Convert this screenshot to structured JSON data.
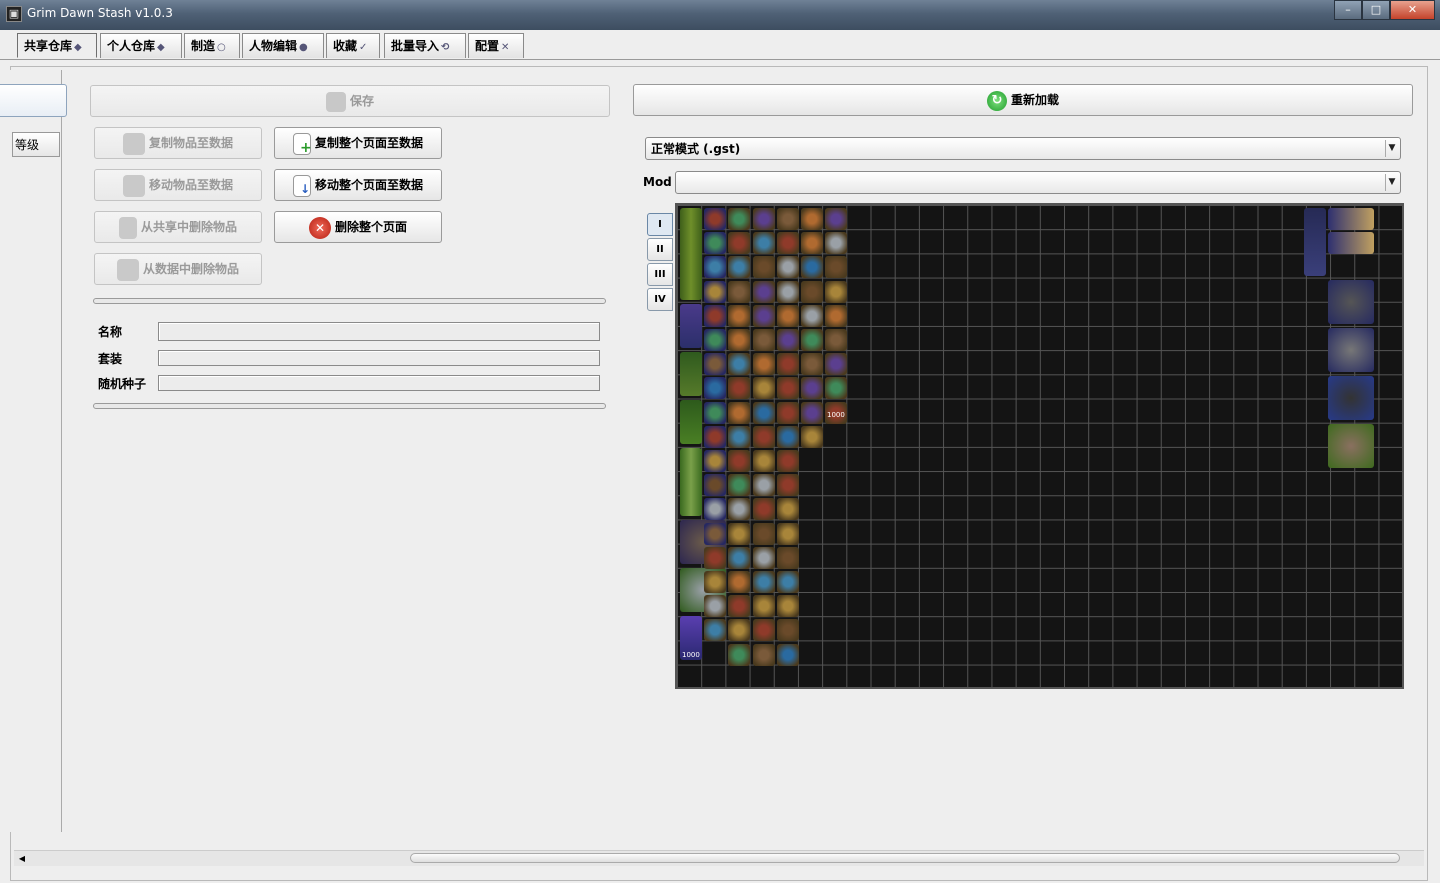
{
  "window": {
    "title": "Grim Dawn Stash v1.0.3",
    "minimize_icon": "minimize-icon",
    "maximize_icon": "maximize-icon",
    "close_icon": "close-icon",
    "minimize_glyph": "–",
    "maximize_glyph": "□",
    "close_glyph": "✕"
  },
  "tabs": [
    {
      "label": "共享仓库",
      "icon": "chest-icon",
      "selected": true
    },
    {
      "label": "个人仓库",
      "icon": "chest-user-icon",
      "selected": false
    },
    {
      "label": "制造",
      "icon": "craft-icon",
      "selected": false
    },
    {
      "label": "人物编辑",
      "icon": "user-icon",
      "selected": false
    },
    {
      "label": "收藏",
      "icon": "collection-icon",
      "selected": false
    },
    {
      "label": "批量导入",
      "icon": "import-icon",
      "selected": false
    },
    {
      "label": "配置",
      "icon": "tools-icon",
      "selected": false
    }
  ],
  "left_panel": {
    "cut_label": "等级"
  },
  "actions": {
    "save": "保存",
    "copy_item_to_db": "复制物品至数据",
    "copy_page_to_db": "复制整个页面至数据",
    "move_item_to_db": "移动物品至数据",
    "move_page_to_db": "移动整个页面至数据",
    "delete_from_shared": "从共享中删除物品",
    "delete_page": "删除整个页面",
    "delete_from_db": "从数据中删除物品"
  },
  "details": {
    "name_label": "名称",
    "name_value": "",
    "set_label": "套装",
    "set_value": "",
    "seed_label": "随机种子",
    "seed_value": ""
  },
  "right": {
    "reload": "重新加载",
    "mode_selected": "正常模式 (.gst)",
    "mod_label": "Mod",
    "mod_selected": ""
  },
  "stash_pages": [
    "I",
    "II",
    "III",
    "IV"
  ],
  "selected_page": "I",
  "stash_badges": [
    "1000",
    "1000"
  ]
}
